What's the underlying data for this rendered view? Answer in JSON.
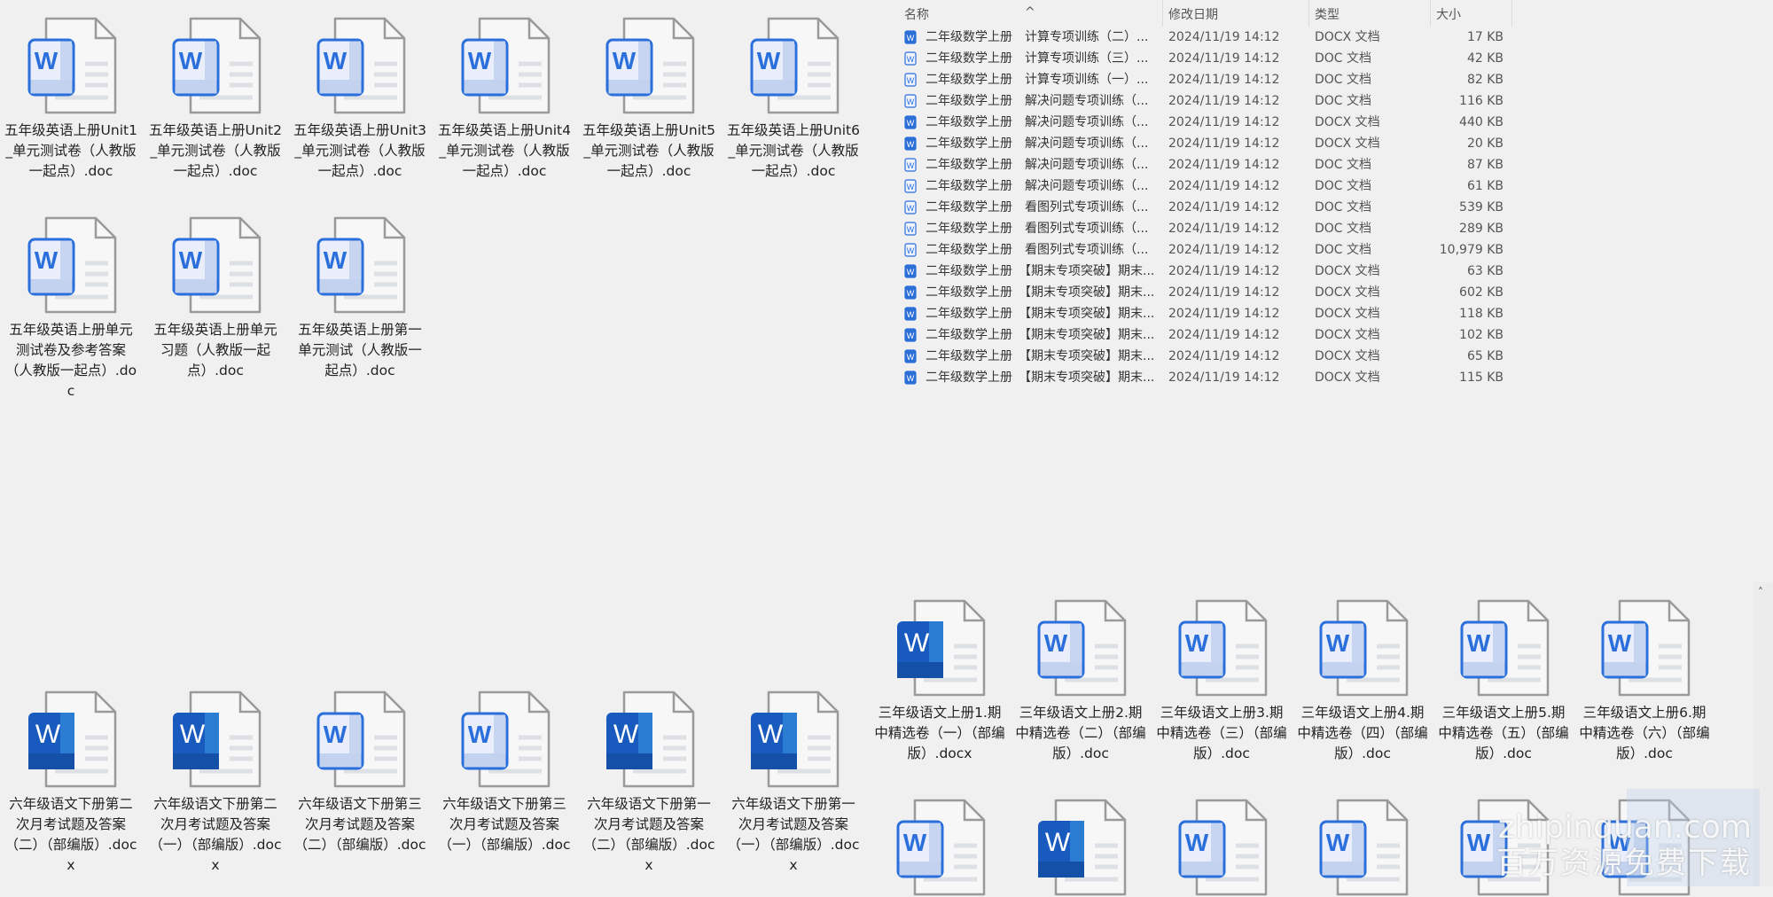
{
  "top_left_grid": [
    {
      "label": "五年级英语上册Unit1_单元测试卷（人教版一起点）.doc",
      "style": "outline"
    },
    {
      "label": "五年级英语上册Unit2_单元测试卷（人教版一起点）.doc",
      "style": "outline"
    },
    {
      "label": "五年级英语上册Unit3_单元测试卷（人教版一起点）.doc",
      "style": "outline"
    },
    {
      "label": "五年级英语上册Unit4_单元测试卷（人教版一起点）.doc",
      "style": "outline"
    },
    {
      "label": "五年级英语上册Unit5_单元测试卷（人教版一起点）.doc",
      "style": "outline"
    },
    {
      "label": "五年级英语上册Unit6_单元测试卷（人教版一起点）.doc",
      "style": "outline"
    },
    {
      "label": "五年级英语上册单元测试卷及参考答案（人教版一起点）.doc",
      "style": "outline"
    },
    {
      "label": "五年级英语上册单元习题（人教版一起点）.doc",
      "style": "outline"
    },
    {
      "label": "五年级英语上册第一单元测试（人教版一起点）.doc",
      "style": "outline"
    }
  ],
  "detail_list": {
    "columns": {
      "name": "名称",
      "date": "修改日期",
      "type": "类型",
      "size": "大小"
    },
    "rows": [
      {
        "name": "二年级数学上册　计算专项训练（二）...",
        "date": "2024/11/19 14:12",
        "type": "DOCX 文档",
        "size": "17 KB",
        "style": "filled"
      },
      {
        "name": "二年级数学上册　计算专项训练（三）...",
        "date": "2024/11/19 14:12",
        "type": "DOC 文档",
        "size": "42 KB",
        "style": "outline"
      },
      {
        "name": "二年级数学上册　计算专项训练（一）...",
        "date": "2024/11/19 14:12",
        "type": "DOC 文档",
        "size": "82 KB",
        "style": "outline"
      },
      {
        "name": "二年级数学上册　解决问题专项训练（...",
        "date": "2024/11/19 14:12",
        "type": "DOC 文档",
        "size": "116 KB",
        "style": "outline"
      },
      {
        "name": "二年级数学上册　解决问题专项训练（...",
        "date": "2024/11/19 14:12",
        "type": "DOCX 文档",
        "size": "440 KB",
        "style": "filled"
      },
      {
        "name": "二年级数学上册　解决问题专项训练（...",
        "date": "2024/11/19 14:12",
        "type": "DOCX 文档",
        "size": "20 KB",
        "style": "filled"
      },
      {
        "name": "二年级数学上册　解决问题专项训练（...",
        "date": "2024/11/19 14:12",
        "type": "DOC 文档",
        "size": "87 KB",
        "style": "outline"
      },
      {
        "name": "二年级数学上册　解决问题专项训练（...",
        "date": "2024/11/19 14:12",
        "type": "DOC 文档",
        "size": "61 KB",
        "style": "outline"
      },
      {
        "name": "二年级数学上册　看图列式专项训练（...",
        "date": "2024/11/19 14:12",
        "type": "DOC 文档",
        "size": "539 KB",
        "style": "outline"
      },
      {
        "name": "二年级数学上册　看图列式专项训练（...",
        "date": "2024/11/19 14:12",
        "type": "DOC 文档",
        "size": "289 KB",
        "style": "outline"
      },
      {
        "name": "二年级数学上册　看图列式专项训练（...",
        "date": "2024/11/19 14:12",
        "type": "DOC 文档",
        "size": "10,979 KB",
        "style": "outline"
      },
      {
        "name": "二年级数学上册　【期末专项突破】期末...",
        "date": "2024/11/19 14:12",
        "type": "DOCX 文档",
        "size": "63 KB",
        "style": "filled"
      },
      {
        "name": "二年级数学上册　【期末专项突破】期末...",
        "date": "2024/11/19 14:12",
        "type": "DOCX 文档",
        "size": "602 KB",
        "style": "filled"
      },
      {
        "name": "二年级数学上册　【期末专项突破】期末...",
        "date": "2024/11/19 14:12",
        "type": "DOCX 文档",
        "size": "118 KB",
        "style": "filled"
      },
      {
        "name": "二年级数学上册　【期末专项突破】期末...",
        "date": "2024/11/19 14:12",
        "type": "DOCX 文档",
        "size": "102 KB",
        "style": "filled"
      },
      {
        "name": "二年级数学上册　【期末专项突破】期末...",
        "date": "2024/11/19 14:12",
        "type": "DOCX 文档",
        "size": "65 KB",
        "style": "filled"
      },
      {
        "name": "二年级数学上册　【期末专项突破】期末...",
        "date": "2024/11/19 14:12",
        "type": "DOCX 文档",
        "size": "115 KB",
        "style": "filled"
      }
    ]
  },
  "bottom_left_grid": [
    {
      "label": "六年级语文下册第二次月考试题及答案（二）（部编版）.docx",
      "style": "filled"
    },
    {
      "label": "六年级语文下册第二次月考试题及答案（一）（部编版）.docx",
      "style": "filled"
    },
    {
      "label": "六年级语文下册第三次月考试题及答案（二）（部编版）.doc",
      "style": "outline"
    },
    {
      "label": "六年级语文下册第三次月考试题及答案（一）（部编版）.doc",
      "style": "outline"
    },
    {
      "label": "六年级语文下册第一次月考试题及答案（二）（部编版）.docx",
      "style": "filled"
    },
    {
      "label": "六年级语文下册第一次月考试题及答案（一）（部编版）.docx",
      "style": "filled"
    }
  ],
  "bottom_right_grid": [
    {
      "label": "三年级语文上册1.期中精选卷（一）（部编版）.docx",
      "style": "filled"
    },
    {
      "label": "三年级语文上册2.期中精选卷（二）（部编版）.doc",
      "style": "outline"
    },
    {
      "label": "三年级语文上册3.期中精选卷（三）（部编版）.doc",
      "style": "outline"
    },
    {
      "label": "三年级语文上册4.期中精选卷（四）（部编版）.doc",
      "style": "outline"
    },
    {
      "label": "三年级语文上册5.期中精选卷（五）（部编版）.doc",
      "style": "outline"
    },
    {
      "label": "三年级语文上册6.期中精选卷（六）（部编版）.doc",
      "style": "outline"
    },
    {
      "label": "",
      "style": "outline"
    },
    {
      "label": "",
      "style": "filled"
    },
    {
      "label": "",
      "style": "outline"
    },
    {
      "label": "",
      "style": "outline"
    },
    {
      "label": "",
      "style": "outline"
    },
    {
      "label": "",
      "style": "outline"
    }
  ],
  "watermark": {
    "line1": "zhipinquan.com",
    "line2": "百万资源免费下载"
  }
}
